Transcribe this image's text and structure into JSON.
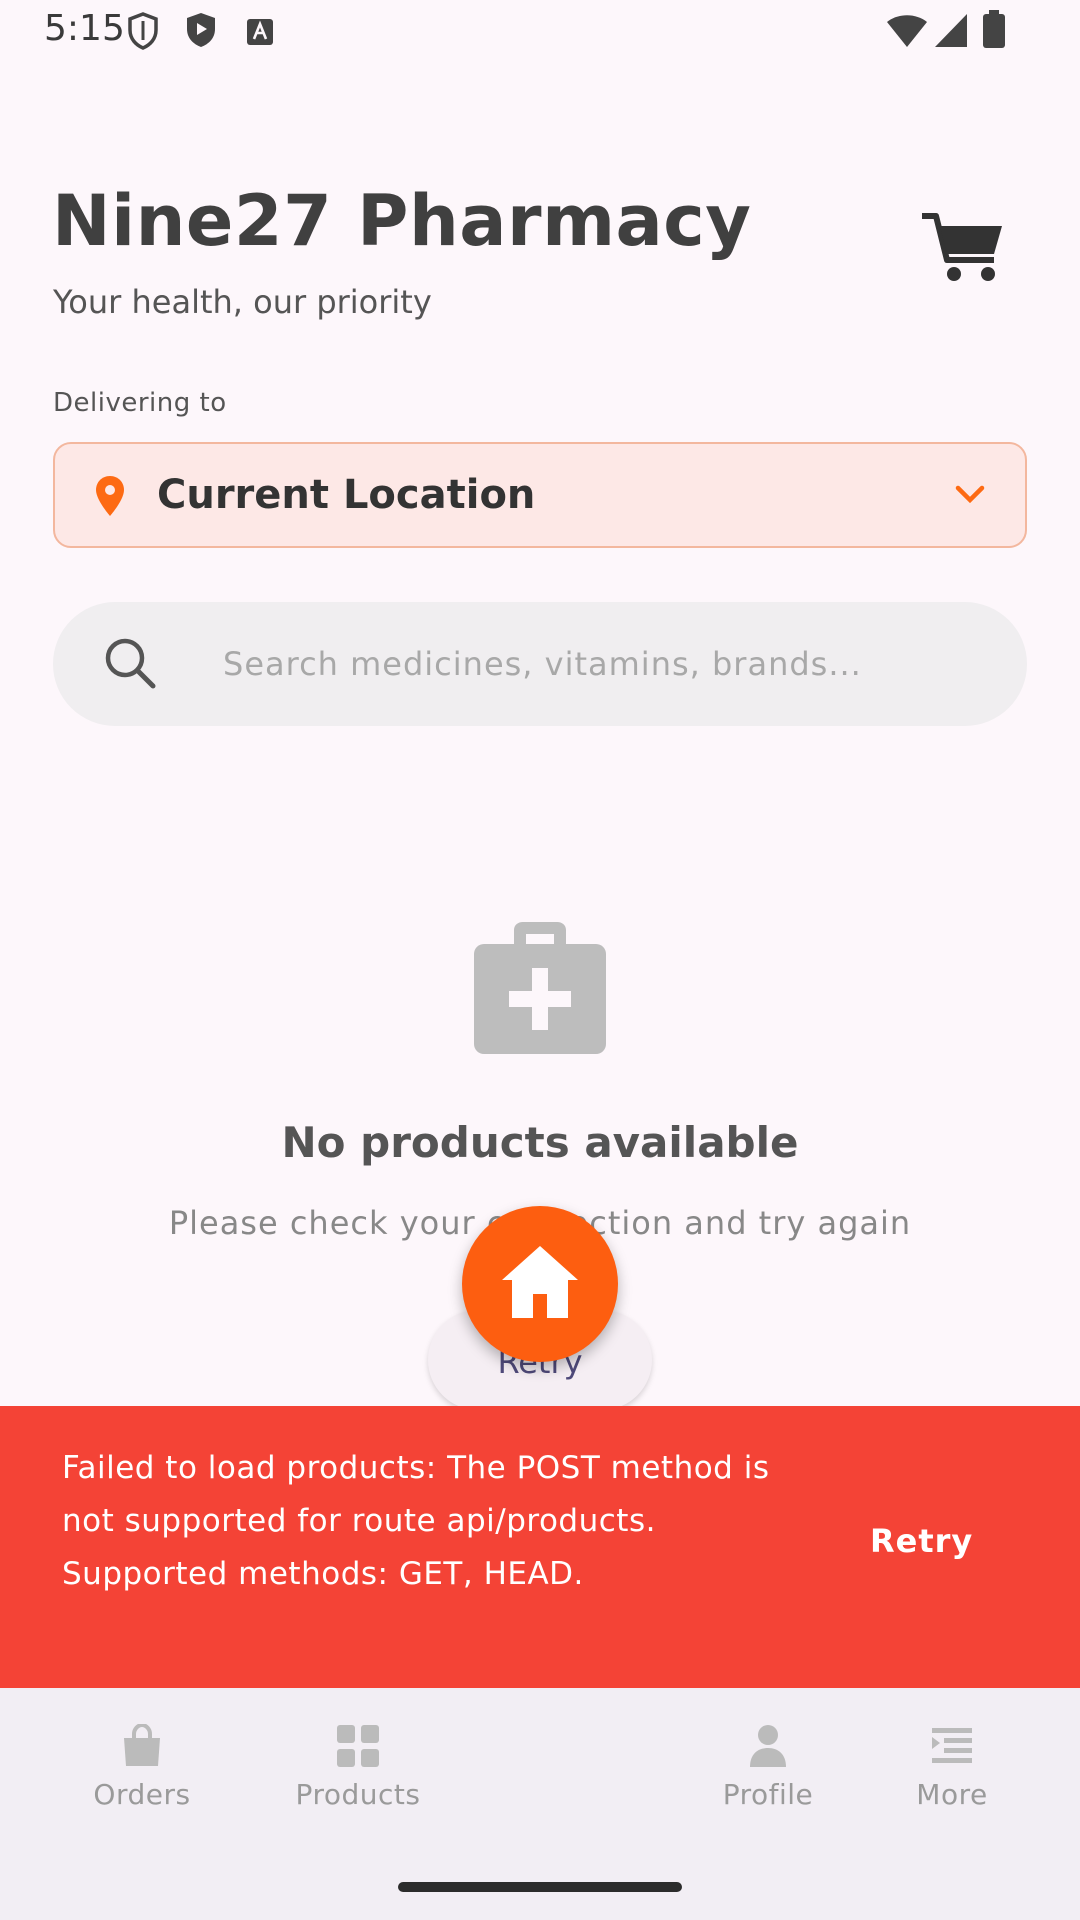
{
  "status_bar": {
    "time": "5:15"
  },
  "header": {
    "title": "Nine27 Pharmacy",
    "subtitle": "Your health, our priority"
  },
  "delivery": {
    "label": "Delivering to",
    "location": "Current Location"
  },
  "search": {
    "placeholder": "Search medicines, vitamins, brands..."
  },
  "empty_state": {
    "title": "No products available",
    "message": "Please check your connection and try again",
    "retry_label": "Retry"
  },
  "snackbar": {
    "message": "Failed to load products: The POST method is not supported for route api/products. Supported methods: GET, HEAD.",
    "action_label": "Retry"
  },
  "bottom_nav": {
    "items": [
      {
        "label": "Orders",
        "icon": "bag-icon"
      },
      {
        "label": "Products",
        "icon": "grid-icon"
      },
      {
        "label": "Profile",
        "icon": "person-icon"
      },
      {
        "label": "More",
        "icon": "menu-icon"
      }
    ],
    "center_icon": "home-icon"
  },
  "colors": {
    "accent": "#fd5e10",
    "error": "#f44336",
    "background": "#fdf7fb"
  }
}
